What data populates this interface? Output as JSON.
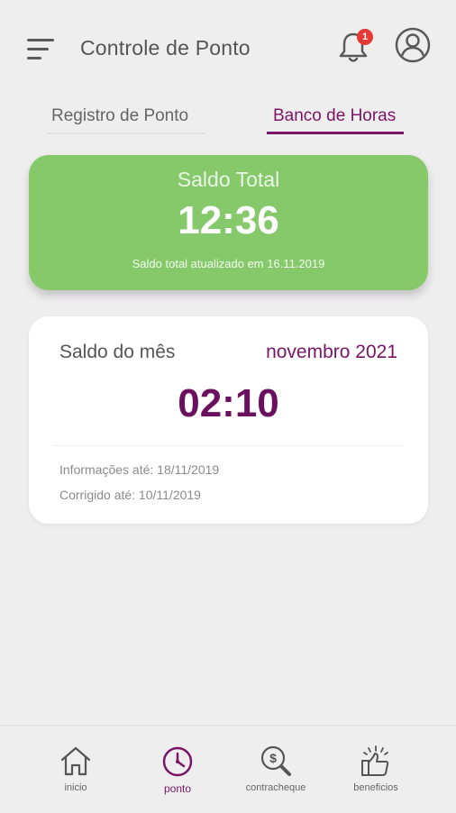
{
  "header": {
    "title": "Controle de Ponto",
    "notification_count": "1"
  },
  "tabs": [
    {
      "label": "Registro de Ponto",
      "active": false
    },
    {
      "label": "Banco de Horas",
      "active": true
    }
  ],
  "saldo_total": {
    "label": "Saldo Total",
    "value": "12:36",
    "updated_text": "Saldo total atualizado em 16.11.2019"
  },
  "saldo_mes": {
    "label": "Saldo do mês",
    "period": "novembro 2021",
    "value": "02:10",
    "info_ate": "Informações até: 18/11/2019",
    "corrigido_ate": "Corrigido até: 10/11/2019"
  },
  "bottom_nav": [
    {
      "label": "inicio",
      "icon": "home-icon",
      "active": false
    },
    {
      "label": "ponto",
      "icon": "clock-icon",
      "active": true
    },
    {
      "label": "contracheque",
      "icon": "money-search-icon",
      "active": false
    },
    {
      "label": "beneficios",
      "icon": "thumbs-up-icon",
      "active": false
    }
  ],
  "colors": {
    "accent": "#7a1466",
    "total_card": "#86c96b",
    "badge": "#e53935",
    "background": "#efeeef"
  }
}
